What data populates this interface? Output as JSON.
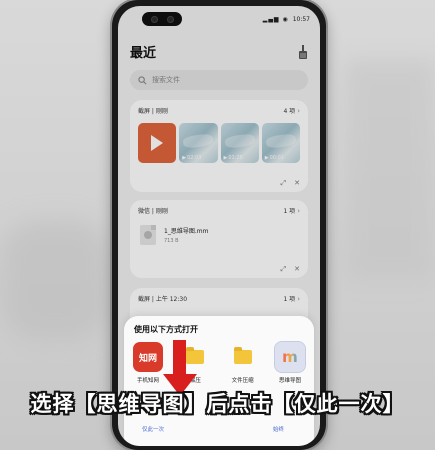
{
  "status": {
    "time": "10:57",
    "icons": "▂▄▆ ◉"
  },
  "page": {
    "title": "最近"
  },
  "search": {
    "placeholder": "搜索文件"
  },
  "cards": [
    {
      "source": "截屏 | 刚刚",
      "count": "4 项",
      "thumbs": [
        {
          "kind": "ppt"
        },
        {
          "kind": "video",
          "time": "02:03"
        },
        {
          "kind": "video",
          "time": "01:25"
        },
        {
          "kind": "video",
          "time": "00:01"
        }
      ]
    },
    {
      "source": "微信 | 刚刚",
      "count": "1 项",
      "file": {
        "name": "1_思维导图.mm",
        "size": "713 B"
      }
    },
    {
      "source": "截屏 | 上午 12:30",
      "count": "1 项"
    }
  ],
  "sheet": {
    "title": "使用以下方式打开",
    "apps": [
      {
        "label": "手机知网",
        "icon": "知网"
      },
      {
        "label": "解压",
        "icon": "folder-icon"
      },
      {
        "label": "文件压缩",
        "icon": "folder-icon"
      },
      {
        "label": "思维导图",
        "icon": "m",
        "selected": true
      }
    ],
    "footer": {
      "once": "仅此一次",
      "always": "始终"
    }
  },
  "caption": "选择【思维导图】后点击【仅此一次】",
  "colors": {
    "accent": "#d91e1e",
    "link": "#4a6bd6"
  }
}
